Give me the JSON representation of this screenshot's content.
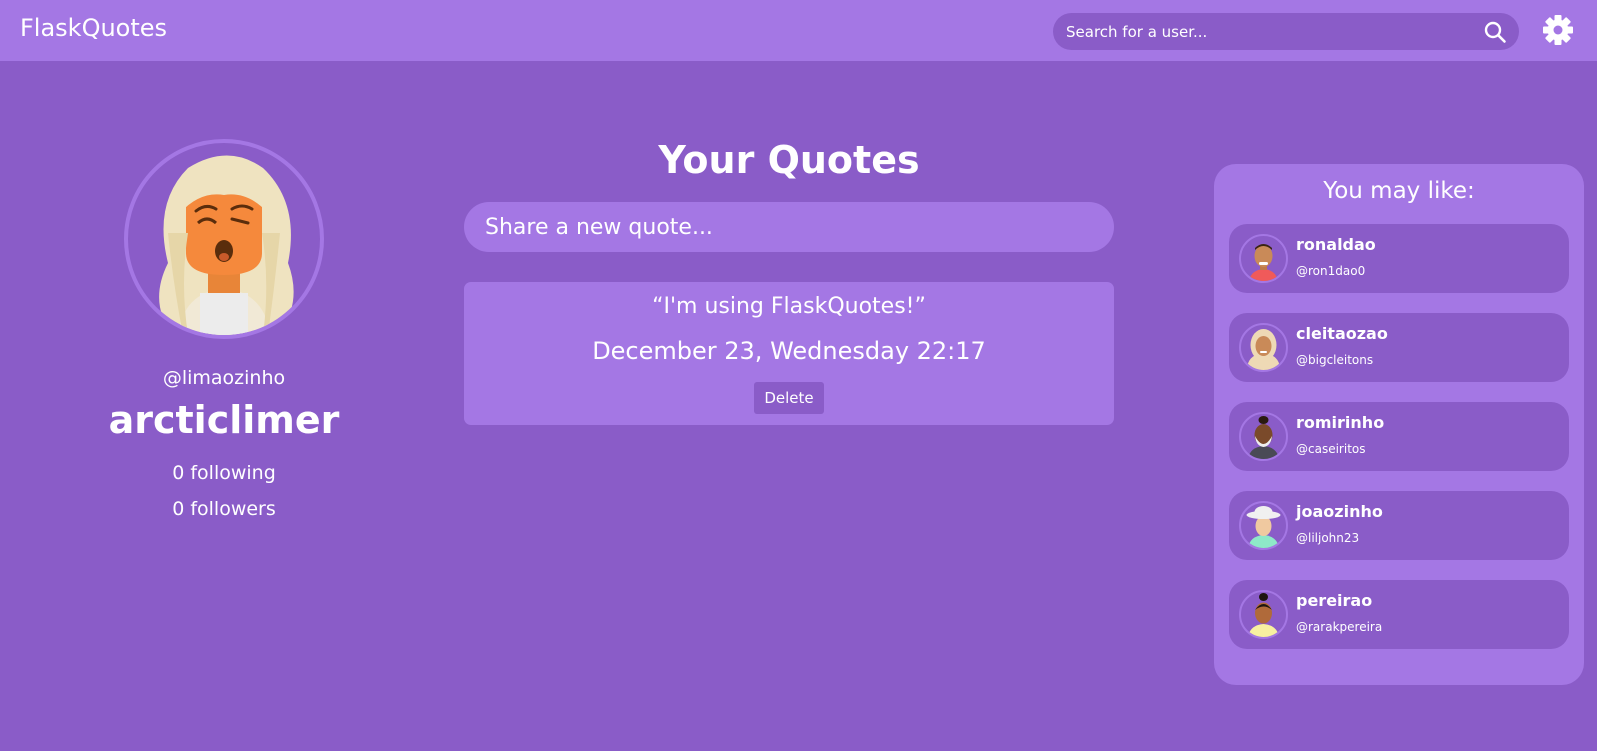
{
  "navbar": {
    "brand": "FlaskQuotes",
    "search_placeholder": "Search for a user..."
  },
  "profile": {
    "handle": "@limaozinho",
    "username": "arcticlimer",
    "following": "0 following",
    "followers": "0 followers"
  },
  "quotes": {
    "title": "Your Quotes",
    "input_placeholder": "Share a new quote...",
    "items": [
      {
        "text": "“I'm using FlaskQuotes!”",
        "date": "December 23, Wednesday 22:17",
        "delete_label": "Delete"
      }
    ]
  },
  "suggestions": {
    "title": "You may like:",
    "users": [
      {
        "name": "ronaldao",
        "handle": "@ron1dao0"
      },
      {
        "name": "cleitaozao",
        "handle": "@bigcleitons"
      },
      {
        "name": "romirinho",
        "handle": "@caseiritos"
      },
      {
        "name": "joaozinho",
        "handle": "@liljohn23"
      },
      {
        "name": "pereirao",
        "handle": "@rarakpereira"
      }
    ]
  },
  "colors": {
    "background": "#8a5cc8",
    "surface": "#a477e4",
    "text": "#ffffff"
  },
  "icons": [
    "search-icon",
    "gear-icon"
  ]
}
